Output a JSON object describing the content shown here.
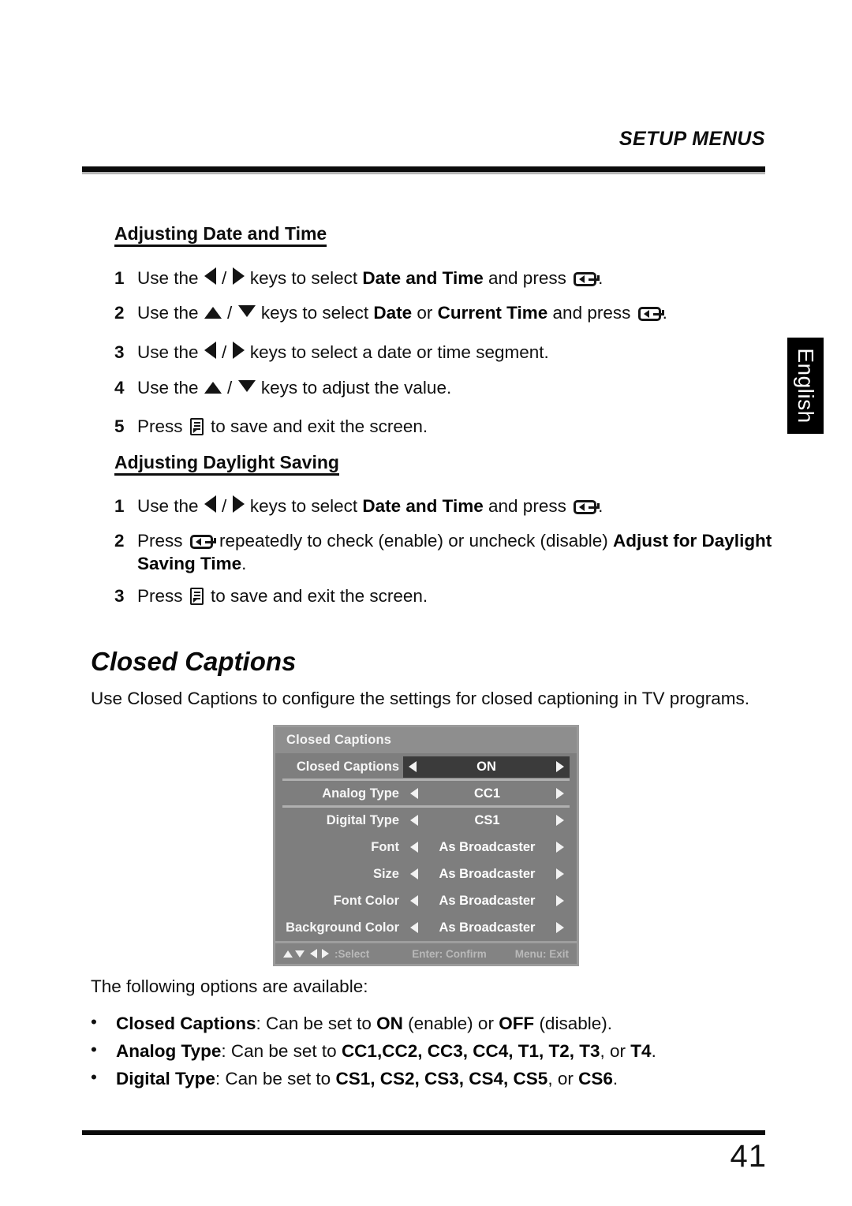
{
  "header": {
    "running_head": "SETUP MENUS"
  },
  "side_tab": {
    "label": "English"
  },
  "sections": {
    "date_time": {
      "heading": "Adjusting Date and Time",
      "steps": [
        {
          "num": "1",
          "pre": "Use the ",
          "mid": " keys to select ",
          "bold1": "Date and Time",
          "mid2": " and press ",
          "post": "."
        },
        {
          "num": "2",
          "pre": "Use the ",
          "mid": " keys to select ",
          "bold1": "Date",
          "conj": " or ",
          "bold2": "Current Time",
          "mid2": " and press ",
          "post": "."
        },
        {
          "num": "3",
          "pre": "Use the ",
          "mid": " keys to select a date or time segment."
        },
        {
          "num": "4",
          "pre": "Use the ",
          "mid": " keys to adjust the value."
        },
        {
          "num": "5",
          "pre": "Press ",
          "mid": " to save and exit the screen."
        }
      ]
    },
    "daylight": {
      "heading": "Adjusting Daylight Saving",
      "steps": [
        {
          "num": "1",
          "pre": "Use the ",
          "mid": " keys to select ",
          "bold1": "Date and Time",
          "mid2": " and press ",
          "post": "."
        },
        {
          "num": "2",
          "pre": "Press ",
          "mid": " repeatedly to check (enable) or uncheck (disable) ",
          "bold1": "Adjust for Daylight Saving Time",
          "post": "."
        },
        {
          "num": "3",
          "pre": "Press ",
          "mid": " to save and exit the screen."
        }
      ]
    },
    "closed_captions": {
      "title": "Closed Captions",
      "intro": "Use Closed Captions to configure the settings for closed captioning in TV programs.",
      "options_lead": "The following options are available:",
      "bullets": [
        {
          "marker": "•",
          "bold1": "Closed Captions",
          "t1": ": Can be set to ",
          "bold2": "ON",
          "t2": " (enable) or ",
          "bold3": "OFF",
          "t3": " (disable)."
        },
        {
          "marker": "•",
          "bold1": "Analog Type",
          "t1": ": Can be set to ",
          "values": "CC1,CC2, CC3, CC4, T1, T2, T3",
          "t2": ", or ",
          "bold3": "T4",
          "t3": "."
        },
        {
          "marker": "•",
          "bold1": "Digital Type",
          "t1": ": Can be set to ",
          "values": "CS1, CS2, CS3, CS4, CS5",
          "t2": ", or ",
          "bold3": "CS6",
          "t3": "."
        }
      ]
    }
  },
  "osd": {
    "title": "Closed Captions",
    "rows": [
      {
        "label": "Closed Captions",
        "value": "ON",
        "active": true,
        "separator": true
      },
      {
        "label": "Analog Type",
        "value": "CC1",
        "active": false,
        "separator": true
      },
      {
        "label": "Digital Type",
        "value": "CS1",
        "active": false,
        "separator": false
      },
      {
        "label": "Font",
        "value": "As Broadcaster",
        "active": false,
        "separator": false
      },
      {
        "label": "Size",
        "value": "As Broadcaster",
        "active": false,
        "separator": false
      },
      {
        "label": "Font Color",
        "value": "As Broadcaster",
        "active": false,
        "separator": false
      },
      {
        "label": "Background Color",
        "value": "As Broadcaster",
        "active": false,
        "separator": false
      }
    ],
    "footer": {
      "select": ":Select",
      "confirm": "Enter: Confirm",
      "exit": "Menu: Exit"
    },
    "colors": {
      "panel_bg": "#7e7e7e",
      "title_bg": "#8e8e8e",
      "active_bg": "#3b3b3b",
      "border": "#9b9b9b",
      "separator": "#b0b0b0",
      "text": "#f6f6f6",
      "footer_text": "#b9b9b9"
    }
  },
  "footer": {
    "page_number": "41"
  }
}
